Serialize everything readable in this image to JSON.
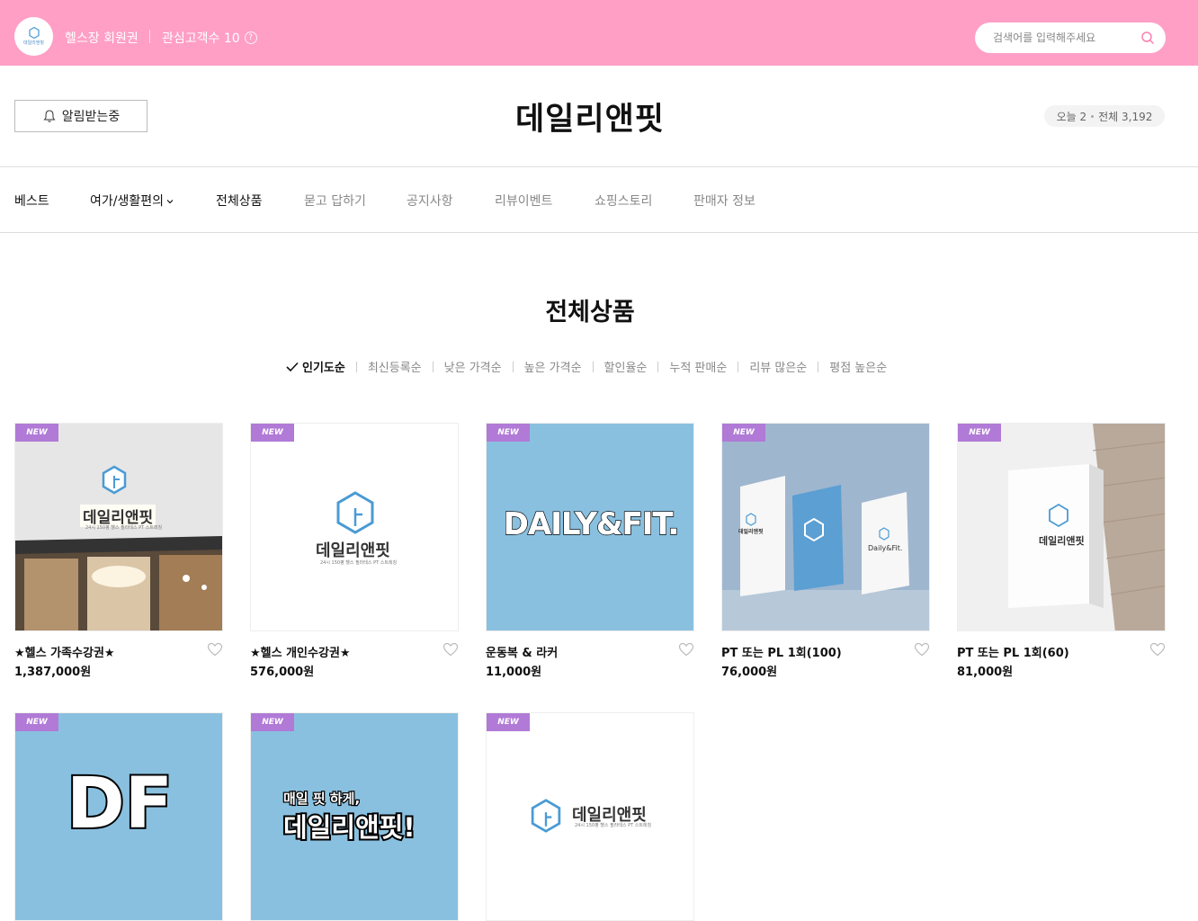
{
  "topbar": {
    "store_name": "헬스장 회원권",
    "fans_label": "관심고객수 10",
    "help": "?",
    "search_placeholder": "검색어를 입력해주세요",
    "logo_text": "데일리앤핏"
  },
  "header": {
    "notify_label": "알림받는중",
    "brand_title": "데일리앤핏",
    "visits_today": "오늘 2",
    "visits_total": "전체 3,192"
  },
  "nav": [
    {
      "label": "베스트"
    },
    {
      "label": "여가/생활편의"
    },
    {
      "label": "전체상품"
    },
    {
      "label": "묻고 답하기"
    },
    {
      "label": "공지사항"
    },
    {
      "label": "리뷰이벤트"
    },
    {
      "label": "쇼핑스토리"
    },
    {
      "label": "판매자 정보"
    }
  ],
  "section": {
    "title": "전체상품",
    "sort_options": [
      "인기도순",
      "최신등록순",
      "낮은 가격순",
      "높은 가격순",
      "할인율순",
      "누적 판매순",
      "리뷰 많은순",
      "평점 높은순"
    ]
  },
  "badge": "NEW",
  "products": [
    {
      "name": "★헬스 가족수강권★",
      "price": "1,387,000원"
    },
    {
      "name": "★헬스 개인수강권★",
      "price": "576,000원"
    },
    {
      "name": "운동복 & 라커",
      "price": "11,000원"
    },
    {
      "name": "PT 또는 PL 1회(100)",
      "price": "76,000원"
    },
    {
      "name": "PT 또는 PL 1회(60)",
      "price": "81,000원"
    },
    {
      "name": "",
      "price": ""
    },
    {
      "name": "",
      "price": ""
    },
    {
      "name": "",
      "price": ""
    }
  ],
  "images": {
    "logo_ko": "데일리앤핏",
    "logo_sub": "24시 150평 헬스 필라테스 PT 스트레칭",
    "daily_fit": "DAILY&FIT.",
    "daily_fit_small": "Daily&Fit.",
    "df": "DF",
    "slogan_line1": "매일 핏 하게,",
    "slogan_line2": "데일리앤핏!"
  },
  "colors": {
    "topbar": "#ff9fc6",
    "badge": "#b07ad6",
    "sky": "#8ac0df",
    "logo_blue": "#4a9bd4"
  }
}
